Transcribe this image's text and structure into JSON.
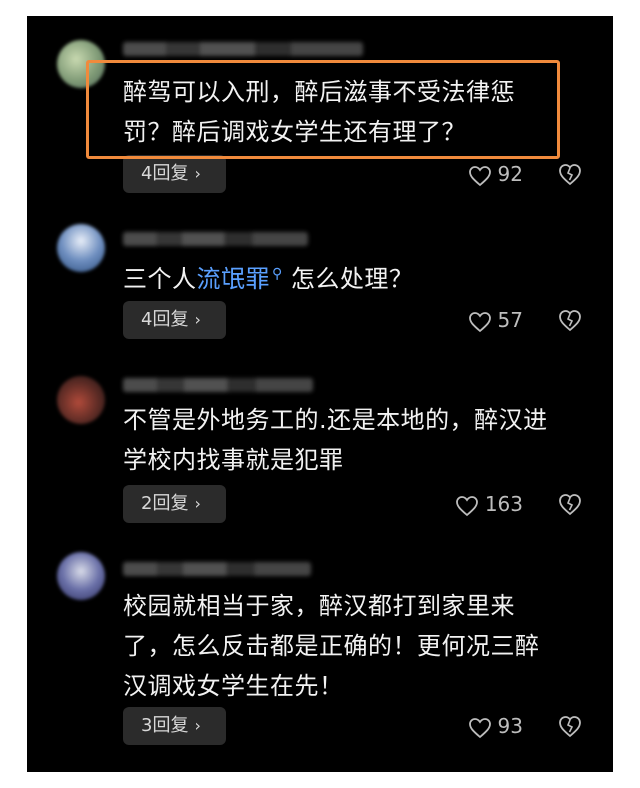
{
  "colors": {
    "background": "#000000",
    "highlight": "#f08a3c",
    "link": "#5aa0ff"
  },
  "comments": [
    {
      "text_lines": [
        "醉驾可以入刑，醉后滋事不受法律惩",
        "罚？醉后调戏女学生还有理了？"
      ],
      "reply_label": "4回复",
      "like_count": "92",
      "highlighted": true
    },
    {
      "text_prefix": "三个人",
      "text_link": "流氓罪",
      "text_suffix": " 怎么处理？",
      "reply_label": "4回复",
      "like_count": "57"
    },
    {
      "text_lines": [
        "不管是外地务工的.还是本地的，醉汉进",
        "学校内找事就是犯罪"
      ],
      "reply_label": "2回复",
      "like_count": "163"
    },
    {
      "text_lines": [
        "校园就相当于家，醉汉都打到家里来",
        "了，怎么反击都是正确的！更何况三醉",
        "汉调戏女学生在先！"
      ],
      "reply_label": "3回复",
      "like_count": "93"
    }
  ],
  "icons": {
    "reply_chevron": "chevron-right-icon",
    "like": "heart-icon",
    "dislike": "broken-heart-icon",
    "search": "search-icon"
  }
}
